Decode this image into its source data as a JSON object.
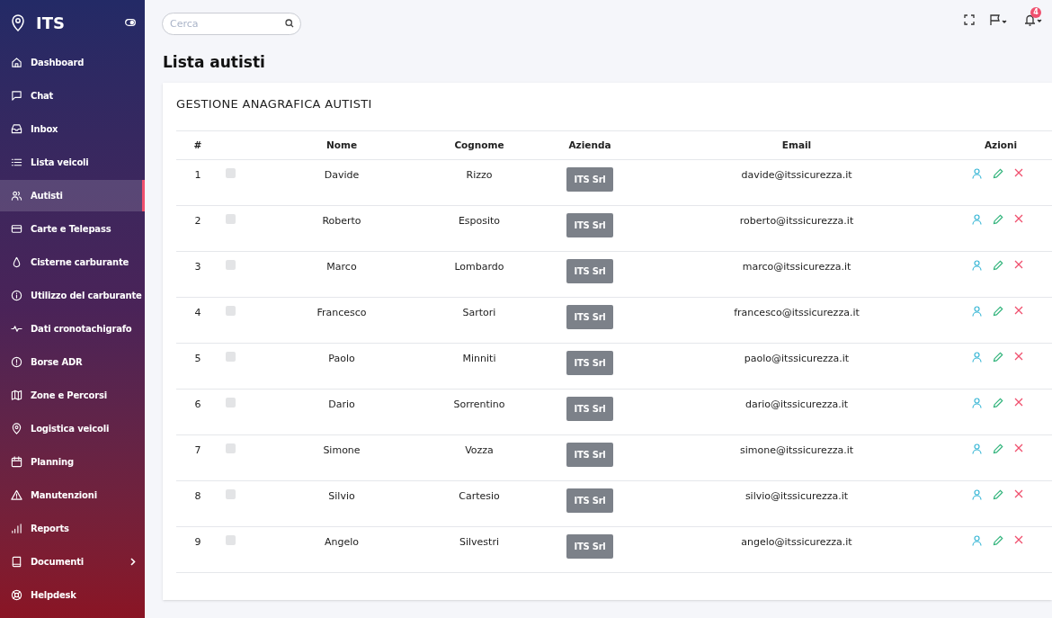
{
  "brand": {
    "title": "ITS"
  },
  "sidebar": {
    "items": [
      {
        "label": "Dashboard",
        "selected": false
      },
      {
        "label": "Chat",
        "selected": false
      },
      {
        "label": "Inbox",
        "selected": false
      },
      {
        "label": "Lista veicoli",
        "selected": false
      },
      {
        "label": "Autisti",
        "selected": true
      },
      {
        "label": "Carte e Telepass",
        "selected": false
      },
      {
        "label": "Cisterne carburante",
        "selected": false
      },
      {
        "label": "Utilizzo del carburante",
        "selected": false
      },
      {
        "label": "Dati cronotachigrafo",
        "selected": false
      },
      {
        "label": "Borse ADR",
        "selected": false
      },
      {
        "label": "Zone e Percorsi",
        "selected": false
      },
      {
        "label": "Logistica veicoli",
        "selected": false
      },
      {
        "label": "Planning",
        "selected": false
      },
      {
        "label": "Manutenzioni",
        "selected": false
      },
      {
        "label": "Reports",
        "selected": false
      },
      {
        "label": "Documenti",
        "selected": false,
        "has_submenu": true
      },
      {
        "label": "Helpdesk",
        "selected": false
      }
    ]
  },
  "search": {
    "placeholder": "Cerca"
  },
  "notifications": {
    "count": "4"
  },
  "page_title": "Lista autisti",
  "card": {
    "title": "GESTIONE ANAGRAFICA AUTISTI"
  },
  "table": {
    "columns": [
      "#",
      "Nome",
      "Cognome",
      "Azienda",
      "Email",
      "Azioni"
    ],
    "rows": [
      {
        "n": "1",
        "checked": false,
        "nome": "Davide",
        "cognome": "Rizzo",
        "azienda": "ITS Srl",
        "email": "davide@itssicurezza.it"
      },
      {
        "n": "2",
        "checked": false,
        "nome": "Roberto",
        "cognome": "Esposito",
        "azienda": "ITS Srl",
        "email": "roberto@itssicurezza.it"
      },
      {
        "n": "3",
        "checked": false,
        "nome": "Marco",
        "cognome": "Lombardo",
        "azienda": "ITS Srl",
        "email": "marco@itssicurezza.it"
      },
      {
        "n": "4",
        "checked": false,
        "nome": "Francesco",
        "cognome": "Sartori",
        "azienda": "ITS Srl",
        "email": "francesco@itssicurezza.it"
      },
      {
        "n": "5",
        "checked": false,
        "nome": "Paolo",
        "cognome": "Minniti",
        "azienda": "ITS Srl",
        "email": "paolo@itssicurezza.it"
      },
      {
        "n": "6",
        "checked": false,
        "nome": "Dario",
        "cognome": "Sorrentino",
        "azienda": "ITS Srl",
        "email": "dario@itssicurezza.it"
      },
      {
        "n": "7",
        "checked": false,
        "nome": "Simone",
        "cognome": "Vozza",
        "azienda": "ITS Srl",
        "email": "simone@itssicurezza.it"
      },
      {
        "n": "8",
        "checked": false,
        "nome": "Silvio",
        "cognome": "Cartesio",
        "azienda": "ITS Srl",
        "email": "silvio@itssicurezza.it"
      },
      {
        "n": "9",
        "checked": false,
        "nome": "Angelo",
        "cognome": "Silvestri",
        "azienda": "ITS Srl",
        "email": "angelo@itssicurezza.it"
      }
    ]
  }
}
